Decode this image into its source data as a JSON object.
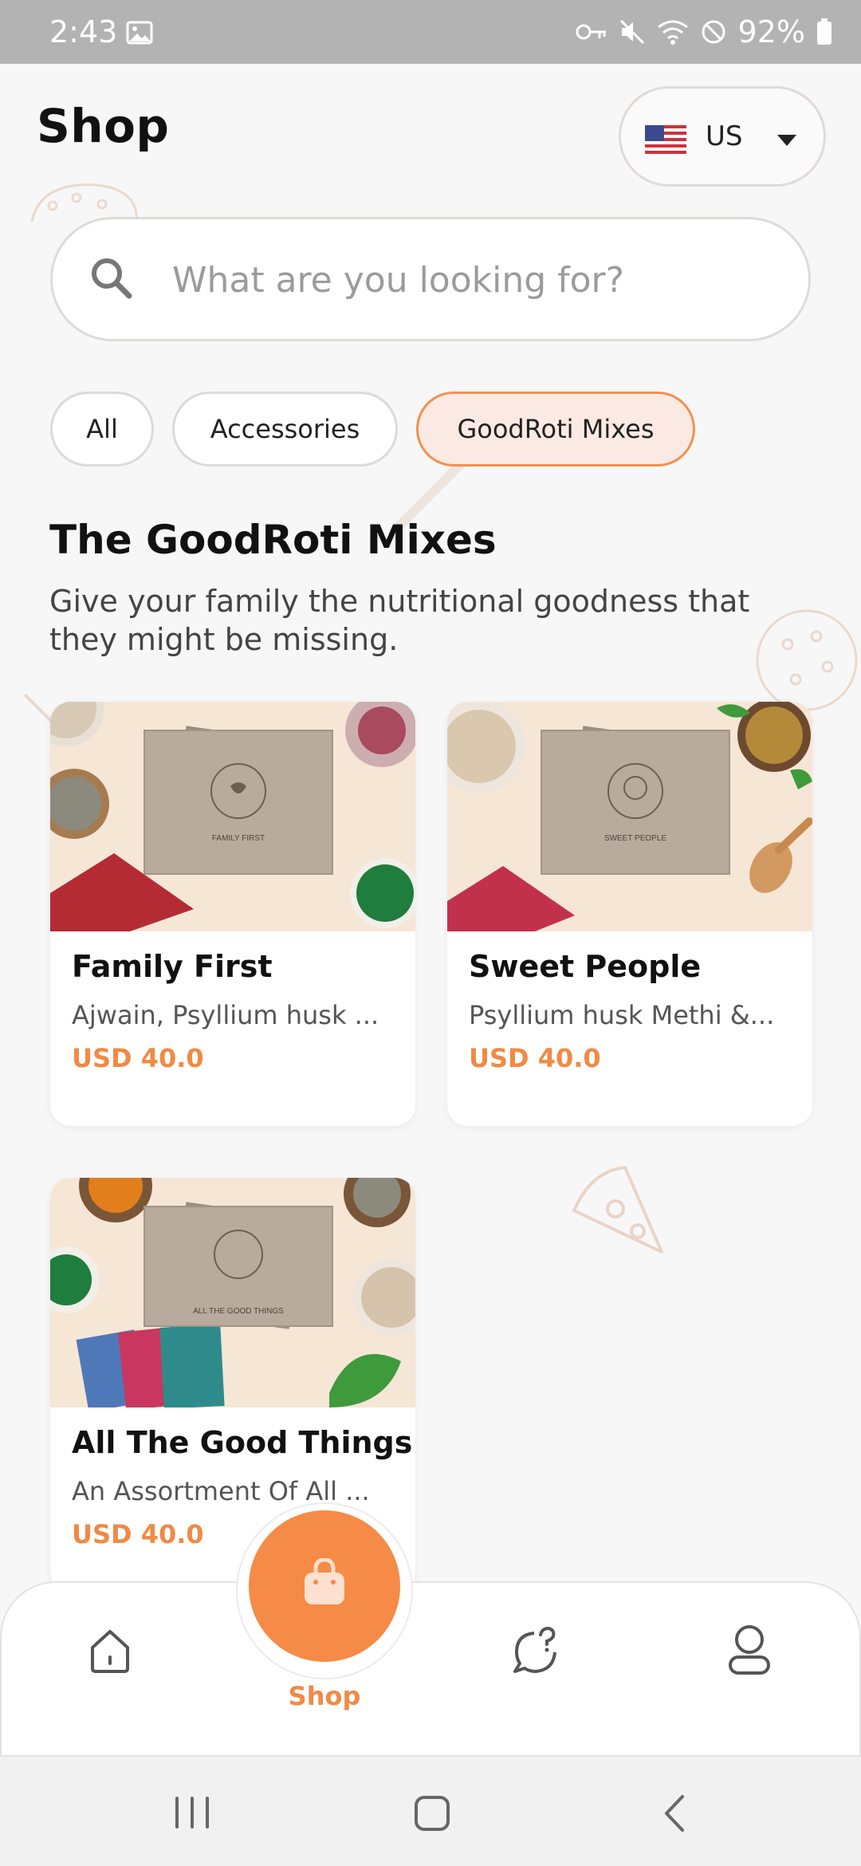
{
  "status_bar": {
    "time": "2:43",
    "battery": "92%",
    "icons": [
      "image-icon",
      "key-icon",
      "mute-icon",
      "wifi-icon",
      "do-not-disturb-icon",
      "battery-icon"
    ]
  },
  "header": {
    "title": "Shop",
    "country": {
      "label": "US",
      "flag": "us-flag-icon"
    }
  },
  "search": {
    "placeholder": "What are you looking for?",
    "value": ""
  },
  "filters": [
    {
      "label": "All",
      "active": false
    },
    {
      "label": "Accessories",
      "active": false
    },
    {
      "label": "GoodRoti Mixes",
      "active": true
    }
  ],
  "section": {
    "title": "The GoodRoti Mixes",
    "subtitle": "Give your family the nutritional goodness that they might be missing."
  },
  "products": [
    {
      "name": "Family First",
      "description": "Ajwain, Psyllium husk ...",
      "price": "USD 40.0",
      "box_label": "FAMILY FIRST"
    },
    {
      "name": "Sweet People",
      "description": "Psyllium husk Methi &...",
      "price": "USD 40.0",
      "box_label": "SWEET PEOPLE"
    },
    {
      "name": "All The Good Things",
      "description": "An Assortment Of All ...",
      "price": "USD 40.0",
      "box_label": "ALL THE GOOD THINGS"
    }
  ],
  "bottom_nav": {
    "items": [
      {
        "name": "home",
        "icon": "home-icon"
      },
      {
        "name": "shop",
        "icon": "shopping-bag-icon",
        "label": "Shop",
        "active": true
      },
      {
        "name": "help",
        "icon": "help-chat-icon"
      },
      {
        "name": "profile",
        "icon": "profile-icon"
      }
    ]
  },
  "colors": {
    "accent": "#f58b47",
    "price": "#f08a45",
    "chip_active_bg": "#fbeae3",
    "background": "#f8f7f7"
  }
}
